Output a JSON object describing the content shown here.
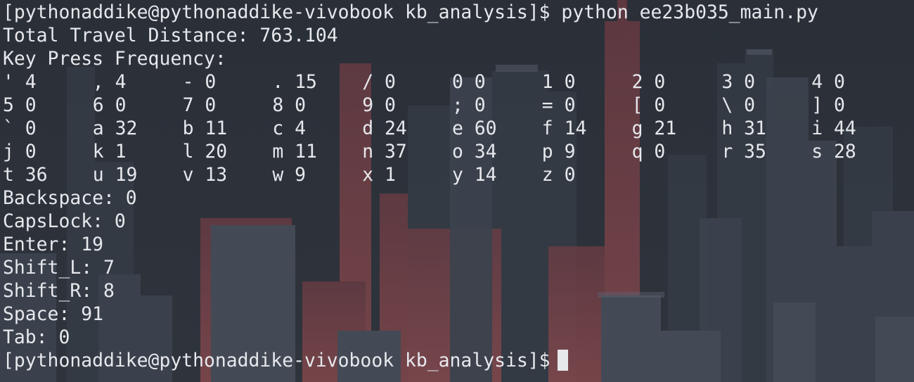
{
  "terminal": {
    "command_line": "[pythonaddike@pythonaddike-vivobook kb_analysis]$ python ee23b035_main.py",
    "total_travel": "Total Travel Distance: 763.104",
    "freq_header": "Key Press Frequency:",
    "freq_rows": [
      [
        "' 4",
        ", 4",
        "- 0",
        ". 15",
        "/ 0",
        "0 0",
        "1 0",
        "2 0",
        "3 0",
        "4 0"
      ],
      [
        "5 0",
        "6 0",
        "7 0",
        "8 0",
        "9 0",
        "; 0",
        "= 0",
        "[ 0",
        "\\ 0",
        "] 0"
      ],
      [
        "` 0",
        "a 32",
        "b 11",
        "c 4",
        "d 24",
        "e 60",
        "f 14",
        "g 21",
        "h 31",
        "i 44"
      ],
      [
        "j 0",
        "k 1",
        "l 20",
        "m 11",
        "n 37",
        "o 34",
        "p 9",
        "q 0",
        "r 35",
        "s 28"
      ],
      [
        "t 36",
        "u 19",
        "v 13",
        "w 9",
        "x 1",
        "y 14",
        "z 0"
      ]
    ],
    "special_keys": [
      "Backspace: 0",
      "CapsLock: 0",
      "Enter: 19",
      "Shift_L: 7",
      "Shift_R: 8",
      "Space: 91",
      "Tab: 0"
    ],
    "prompt": "[pythonaddike@pythonaddike-vivobook kb_analysis]$"
  },
  "colors": {
    "text": "#e6e8ec",
    "background": "#2b3039",
    "accent_red": "#8f4a4c"
  }
}
